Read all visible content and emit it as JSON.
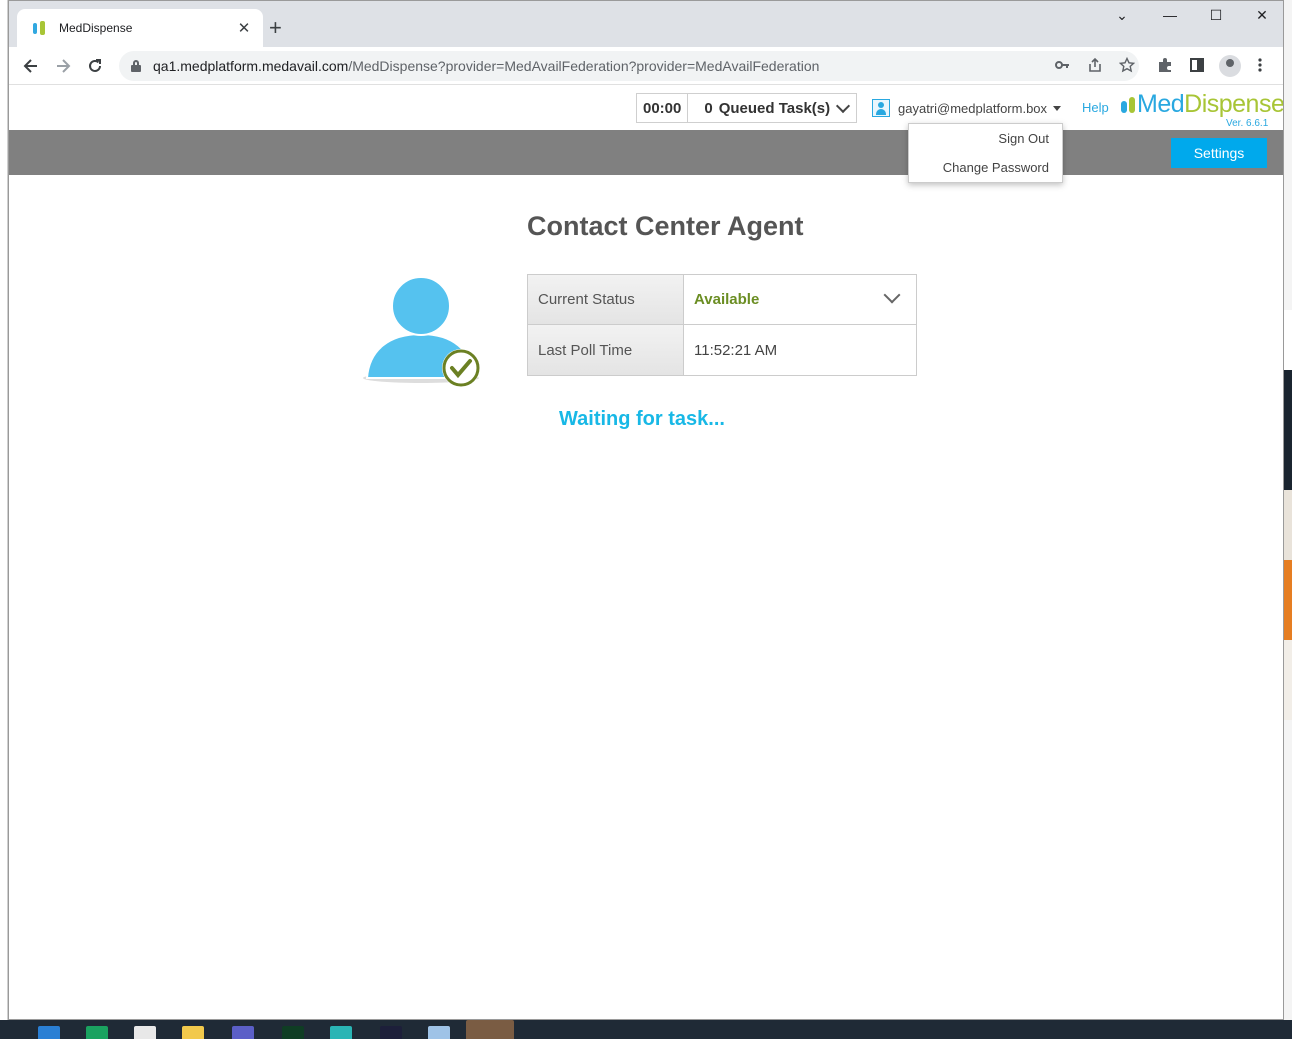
{
  "browser": {
    "tab_title": "MedDispense",
    "tab_close": "✕",
    "new_tab": "+",
    "url_host": "qa1.medplatform.medavail.com",
    "url_path": "/MedDispense?provider=MedAvailFederation?provider=MedAvailFederation",
    "window_controls": {
      "dropdown": "⌄",
      "minimize": "—",
      "maximize": "☐",
      "close": "✕"
    }
  },
  "header": {
    "timer": "00:00",
    "queued_count": "0",
    "queued_label": "Queued Task(s)",
    "user_email": "gayatri@medplatform.box",
    "help": "Help",
    "logo_med": "Med",
    "logo_dispense": "Dispense",
    "logo_version": "Ver. 6.6.1"
  },
  "toolbar": {
    "settings_label": "Settings"
  },
  "user_dropdown": {
    "items": [
      {
        "label": "Sign Out"
      },
      {
        "label": "Change Password"
      }
    ]
  },
  "main": {
    "title": "Contact Center Agent",
    "status_rows": [
      {
        "label": "Current Status",
        "value": "Available"
      },
      {
        "label": "Last Poll Time",
        "value": "11:52:21 AM"
      }
    ],
    "waiting_text": "Waiting for task..."
  },
  "colors": {
    "accent": "#00a9ec",
    "available": "#6b8e23",
    "waiting": "#18b8e6",
    "logo_blue": "#29a8e0",
    "logo_green": "#a8c536"
  },
  "icons": [
    "back-icon",
    "forward-icon",
    "reload-icon",
    "lock-icon",
    "key-icon",
    "share-icon",
    "star-icon",
    "extensions-icon",
    "side-panel-icon",
    "profile-icon",
    "kebab-menu-icon",
    "user-icon",
    "agent-available-icon",
    "check-icon"
  ]
}
